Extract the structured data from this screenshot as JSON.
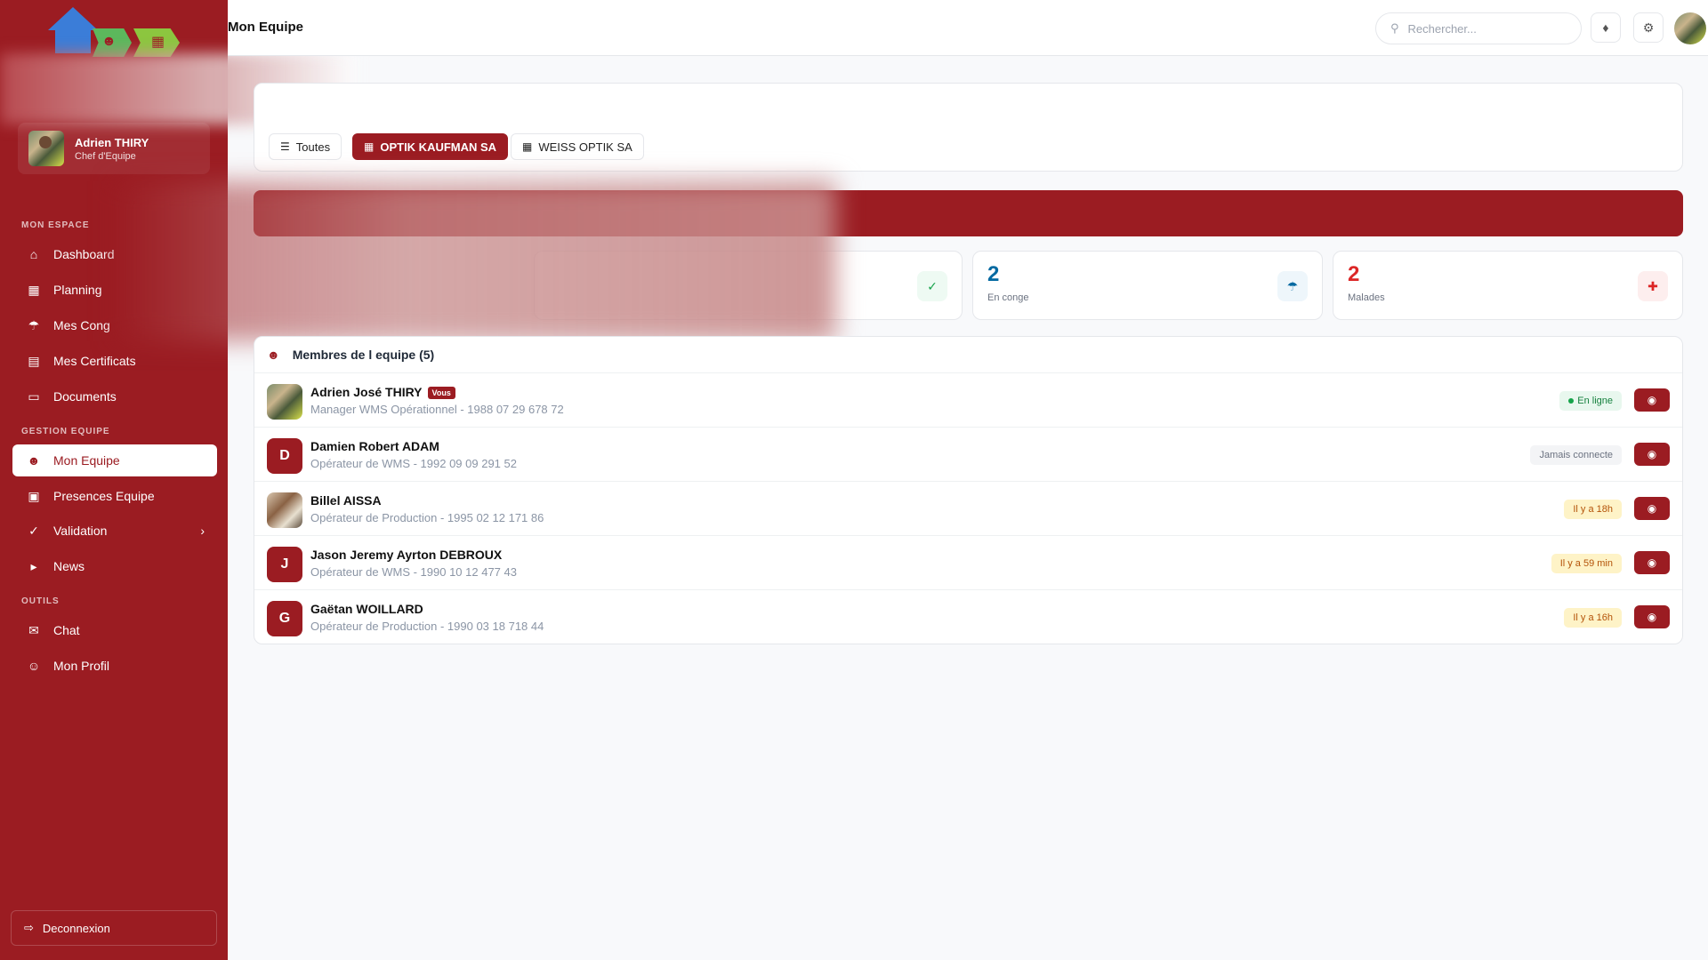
{
  "app": {
    "page_title": "Mon Equipe"
  },
  "user": {
    "name": "Adrien THIRY",
    "role": "Chef d'Equipe"
  },
  "sidebar": {
    "sections": {
      "mon_espace": "MON ESPACE",
      "gestion": "GESTION EQUIPE",
      "outils": "OUTILS"
    },
    "items": [
      {
        "label": "Dashboard",
        "icon": "home-icon"
      },
      {
        "label": "Planning",
        "icon": "calendar-icon"
      },
      {
        "label": "Mes Cong",
        "icon": "umbrella-beach-icon"
      },
      {
        "label": "Mes Certificats",
        "icon": "file-medical-icon"
      },
      {
        "label": "Documents",
        "icon": "folder-icon"
      },
      {
        "label": "Mon Equipe",
        "icon": "users-icon"
      },
      {
        "label": "Presences Equipe",
        "icon": "calendar-check-icon"
      },
      {
        "label": "Validation",
        "icon": "check-double-icon"
      },
      {
        "label": "News",
        "icon": "megaphone-icon"
      },
      {
        "label": "Chat",
        "icon": "chat-icon"
      },
      {
        "label": "Mon Profil",
        "icon": "user-gear-icon"
      }
    ],
    "logout": "Deconnexion"
  },
  "topbar": {
    "search_placeholder": "Rechercher..."
  },
  "filters": {
    "all": "Toutes",
    "company1": "OPTIK KAUFMAN SA",
    "company2": "WEISS OPTIK SA",
    "selected": "OPTIK KAUFMAN SA"
  },
  "stats": {
    "conge": {
      "value": "2",
      "label": "En conge"
    },
    "malades": {
      "value": "2",
      "label": "Malades"
    }
  },
  "members": {
    "header": "Membres de l equipe (5)",
    "rows": [
      {
        "name": "Adrien José THIRY",
        "badge": "Vous",
        "subtitle": "Manager WMS Opérationnel - 1988 07 29 678 72",
        "status": "En ligne",
        "status_type": "online"
      },
      {
        "name": "Damien Robert ADAM",
        "initial": "D",
        "subtitle": "Opérateur de WMS - 1992 09 09 291 52",
        "status": "Jamais connecte",
        "status_type": "never"
      },
      {
        "name": "Billel AISSA",
        "subtitle": "Opérateur de Production - 1995 02 12 171 86",
        "status": "Il y a 18h",
        "status_type": "recent"
      },
      {
        "name": "Jason Jeremy Ayrton DEBROUX",
        "initial": "J",
        "subtitle": "Opérateur de WMS - 1990 10 12 477 43",
        "status": "Il y a 59 min",
        "status_type": "recent"
      },
      {
        "name": "Gaëtan WOILLARD",
        "initial": "G",
        "subtitle": "Opérateur de Production - 1990 03 18 718 44",
        "status": "Il y a 16h",
        "status_type": "recent"
      }
    ]
  },
  "colors": {
    "brand": "#9b1c22",
    "online": "#16a34a",
    "info": "#0369a1",
    "danger": "#dc2626"
  }
}
